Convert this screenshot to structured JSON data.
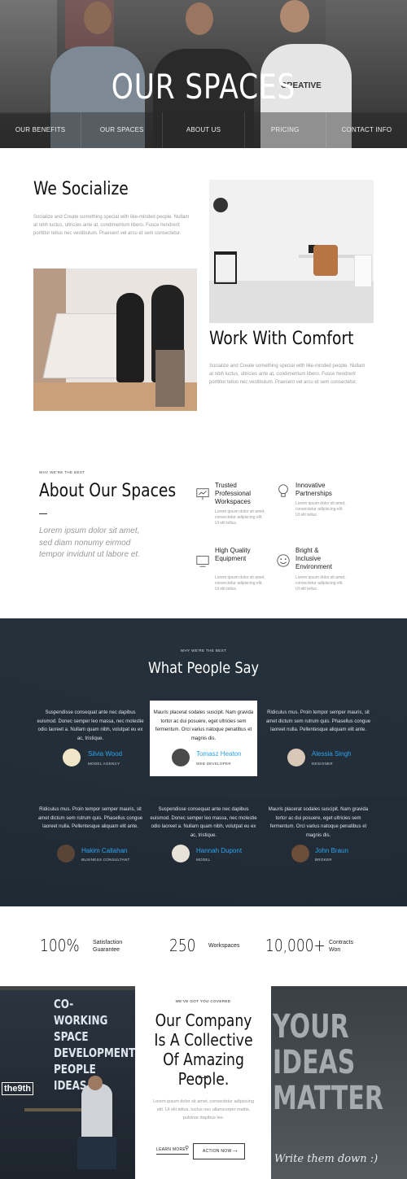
{
  "hero": {
    "title": "OUR SPACES",
    "nav": [
      "OUR BENEFITS",
      "OUR SPACES",
      "ABOUT US",
      "PRICING",
      "CONTACT INFO"
    ],
    "shirt_text": "CREATIVE"
  },
  "socialize": {
    "title": "We Socialize",
    "text": "Socialize and Create something special with like-minded people. Nullam at nibh luctus, ultricies ante at, condimentum libero. Fusce hendrerit porttitor tellus nec vestibulum. Praesent vel arcu et sem consectetur."
  },
  "comfort": {
    "title": "Work With Comfort",
    "text": "Socialize and Create something special with like-minded people. Nullam at nibh luctus, ultricies ante at, condimentum libero. Fusce hendrerit porttitor tellus nec vestibulum. Praesent vel arcu et sem consectetur."
  },
  "about": {
    "eyebrow": "WHY WE'RE THE BEST",
    "title": "About Our Spaces",
    "quote": "Lorem ipsum dolor sit amet, sed diam nonumy eirmod tempor invidunt ut labore et.",
    "features": [
      {
        "icon": "presentation-board-icon",
        "title": "Trusted Professional Workspaces",
        "text": "Lorem ipsum dolor sit amet, consectetur adipiscing elit. Ut elit tellus."
      },
      {
        "icon": "lightbulb-icon",
        "title": "Innovative Partnerships",
        "text": "Lorem ipsum dolor sit amet, consectetur adipiscing elit. Ut elit tellus."
      },
      {
        "icon": "monitor-icon",
        "title": "High Quality Equipment",
        "text": "Lorem ipsum dolor sit amet, consectetur adipiscing elit. Ut elit tellus."
      },
      {
        "icon": "smiley-icon",
        "title": "Bright & Inclusive Environment",
        "text": "Lorem ipsum dolor sit amet, consectetur adipiscing elit. Ut elit tellus."
      }
    ]
  },
  "testimonials": {
    "eyebrow": "WHY WE'RE THE BEST",
    "title": "What People Say",
    "items": [
      {
        "quote": "Suspendisse consequat ante nec dapibus euismod. Donec semper leo massa, nec molestie odio laoreet a. Nullam quam nibh, volutpat eu ex ac, tristique.",
        "name": "Silvia Wood",
        "role": "MODEL AGENCY"
      },
      {
        "quote": "Mauris placerat sodales suscipit. Nam gravida tortor ac dui posuere, eget ultricies sem fermentum. Orci varius natoque penatibus et magnis dis.",
        "name": "Tomasz Heaton",
        "role": "WEB DEVELOPER"
      },
      {
        "quote": "Ridiculus mus. Proin tempor semper mauris, sit amet dictum sem rutrum quis. Phasellus congue laoreet nulla. Pellentesque aliquam elit ante.",
        "name": "Alessia Singh",
        "role": "DESIGNER"
      },
      {
        "quote": "Ridiculus mus. Proin tempor semper mauris, sit amet dictum sem rutrum quis. Phasellus congue laoreet nulla. Pellentesque aliquam elit ante.",
        "name": "Hakim Callahan",
        "role": "BUSINESS CONSULTANT"
      },
      {
        "quote": "Suspendisse consequat ante nec dapibus euismod. Donec semper leo massa, nec molestie odio laoreet a. Nullam quam nibh, volutpat eu ex ac, tristique.",
        "name": "Hannah Dupont",
        "role": "MODEL"
      },
      {
        "quote": "Mauris placerat sodales suscipit. Nam gravida tortor ac dui posuere, eget ultricies sem fermentum. Orci varius natoque penatibus et magnis dis.",
        "name": "John Braun",
        "role": "BROKER"
      }
    ]
  },
  "stats": [
    {
      "value": "100%",
      "label": "Satisfaction Guarantee"
    },
    {
      "value": "250",
      "label": "Workspaces"
    },
    {
      "value": "10,000+",
      "label": "Contracts Won"
    }
  ],
  "company": {
    "eyebrow": "WE'VE GOT YOU COVERED",
    "title": "Our Company Is A Collective Of Amazing People.",
    "text": "Lorem ipsum dolor sit amet, consectetur adipiscing elit. Ut elit tellus, luctus nec ullamcorper mattis, pulvinar dapibus leo.",
    "learn_more": "LEARN MORE",
    "action_now": "ACTION NOW",
    "window_text": "CO-WORKING SPACE DEVELOPMENT PEOPLE IDEAS",
    "window_sign": "the9th",
    "poster_text": "YOUR IDEAS MATTER",
    "poster_sub": "Write them down :)"
  },
  "colors": {
    "accent": "#2ea3f2",
    "dark_bg": "#2a3642"
  }
}
